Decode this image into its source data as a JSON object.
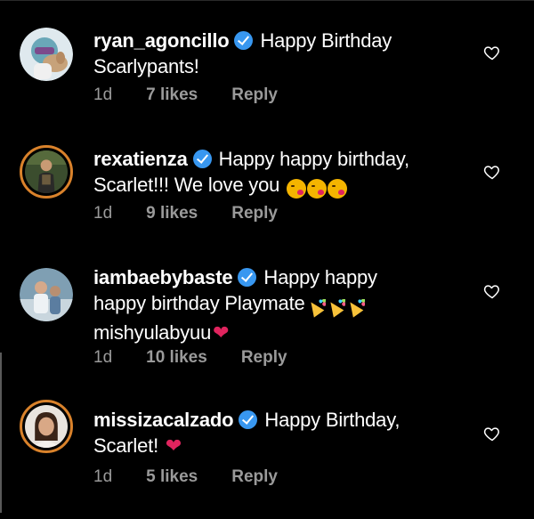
{
  "comments": [
    {
      "username": "ryan_agoncillo",
      "verified": true,
      "text_line1": "Happy Birthday",
      "text_line2": "Scarlypants!",
      "age": "1d",
      "likes": "7 likes",
      "reply": "Reply"
    },
    {
      "username": "rexatienza",
      "verified": true,
      "text_line1": "Happy happy birthday,",
      "text_line2": "Scarlet!!! We love you",
      "age": "1d",
      "likes": "9 likes",
      "reply": "Reply"
    },
    {
      "username": "iambaebybaste",
      "verified": true,
      "text_line1": "Happy happy",
      "text_line2": "happy birthday Playmate",
      "text_line3": "mishyulabyuu",
      "age": "1d",
      "likes": "10 likes",
      "reply": "Reply"
    },
    {
      "username": "missizacalzado",
      "verified": true,
      "text_line1": "Happy Birthday,",
      "text_line2": "Scarlet!",
      "age": "1d",
      "likes": "5 likes",
      "reply": "Reply"
    }
  ],
  "icons": {
    "verified": "verified-badge-icon",
    "like": "heart-outline-icon",
    "heart_emoji": "red-heart-emoji",
    "kiss_emoji": "face-blowing-kiss-emoji",
    "party_emoji": "party-popper-emoji"
  },
  "colors": {
    "background": "#000000",
    "verified": "#3897f0",
    "meta_text": "#9a9a9a",
    "story_ring": "#d9822b",
    "heart": "#e0245e"
  }
}
